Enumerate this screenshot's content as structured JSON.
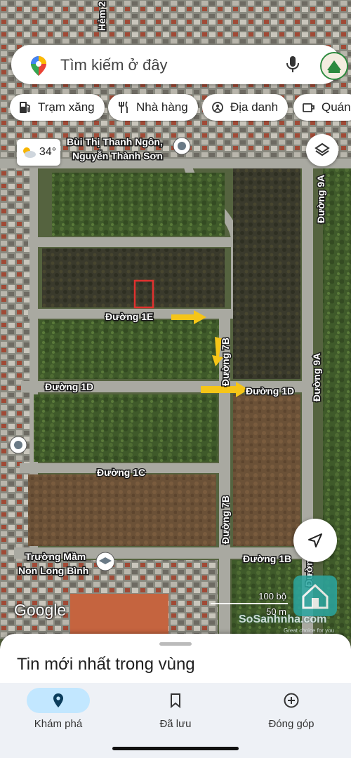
{
  "search": {
    "placeholder": "Tìm kiếm ở đây"
  },
  "chips": [
    {
      "label": "Trạm xăng",
      "icon": "gas-station-icon"
    },
    {
      "label": "Nhà hàng",
      "icon": "restaurant-icon"
    },
    {
      "label": "Địa danh",
      "icon": "landmark-icon"
    },
    {
      "label": "Quán",
      "icon": "cafe-icon"
    }
  ],
  "weather": {
    "temperature": "34°",
    "icon": "partly-cloudy-icon"
  },
  "map_labels": {
    "top_left_partial": "Hẻm 2",
    "place_name_line1": "Bùi Thị Thanh Ngôn,",
    "place_name_line2": "Nguyễn Thành Sơn",
    "school_line1": "Trường Mầm",
    "school_line2": "Non Long Bình",
    "roads": {
      "road_1e": "Đường 1E",
      "road_1d_left": "Đường 1D",
      "road_1d_right": "Đường 1D",
      "road_1c": "Đường 1C",
      "road_1b": "Đường 1B",
      "road_7b_top": "Đường 7B",
      "road_7b_bottom": "Đường 7B",
      "road_9a_top": "Đường 9A",
      "road_9a_mid": "Đường 9A",
      "road_9_partial": "Đường 9"
    }
  },
  "scale": {
    "upper": "100 bộ",
    "lower": "50 m"
  },
  "attribution": "Google",
  "watermark": {
    "text": "SoSanhnha.com",
    "tagline": "Great choice for you"
  },
  "sheet": {
    "title": "Tin mới nhất trong vùng"
  },
  "bottom_nav": [
    {
      "label": "Khám phá",
      "icon": "explore-pin-icon",
      "active": true
    },
    {
      "label": "Đã lưu",
      "icon": "bookmark-icon",
      "active": false
    },
    {
      "label": "Đóng góp",
      "icon": "add-circle-icon",
      "active": false
    }
  ],
  "colors": {
    "accent_active_pill": "#c2e7ff",
    "marker_red": "#e0312f",
    "arrow_yellow": "#f5c518"
  }
}
